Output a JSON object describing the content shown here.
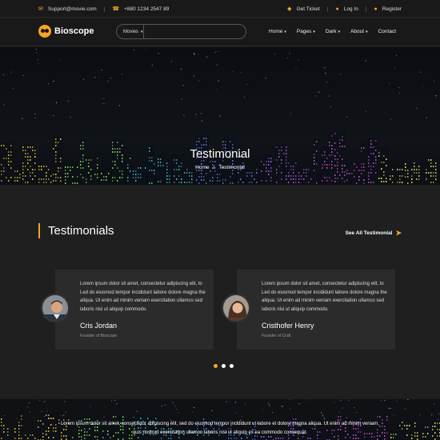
{
  "topbar": {
    "email": "Support@movie.com",
    "phone": "+880 1234 2547 89",
    "get_ticket": "Get Ticket",
    "login": "Log In",
    "register": "Register"
  },
  "nav": {
    "logo_text": "Bioscope",
    "search_category": "Movies",
    "search_placeholder": "",
    "menu": [
      "Home",
      "Pages",
      "Dark",
      "About",
      "Contact"
    ]
  },
  "hero": {
    "title": "Testimonial",
    "crumb_home": "Home",
    "crumb_sep": "/",
    "crumb_current": "Testimonial"
  },
  "testimonials": {
    "heading": "Testimonials",
    "see_all": "See All Testimonial",
    "cards": [
      {
        "text": "Lorem ipsum dolor sit amet, consectetur adipiscing elit, to Led do eiusmod tempor incididunt labore dolore magna the aliqua. Ut enim ad minim veniam exercitation ullamco sed laboris nisi ut aliquip commodo.",
        "name": "Cris Jordan",
        "role": "Founder of Bioscope"
      },
      {
        "text": "Lorem ipsum dolor sit amet, consectetur adipiscing elit, to Led do eiusmod tempor incididunt labore dolore magna the aliqua. Ut enim ad minim veniam exercitation ullamco sed laboris nisi ut aliquip commodo.",
        "name": "Cristhofer Henry",
        "role": "Founder of Craft"
      }
    ],
    "pager_count": 3,
    "pager_active": 1
  },
  "footer": {
    "text": "Lorem ipsum dolor sit amet, consectetur adipiscing elit, sed do eiusmod tempor incididunt ut labore et dolore magna aliqua. Ut enim ad minim veniam, quis nostrud exercitation ullamco laboris nisi ut aliquip ex ea commodo consequat."
  },
  "colors": {
    "accent": "#f5a623",
    "bg": "#1f1f1f",
    "card": "#2b2b2b"
  }
}
